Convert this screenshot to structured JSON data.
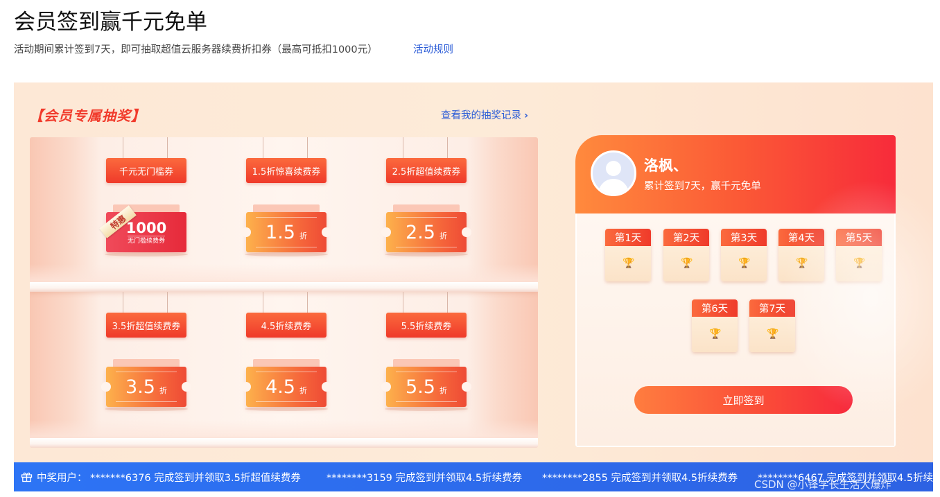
{
  "header": {
    "title": "会员签到赢千元免单",
    "description": "活动期间累计签到7天，即可抽取超值云服务器续费折扣券（最高可抵扣1000元）",
    "rules_link": "活动规则"
  },
  "lottery": {
    "title": "【会员专属抽奖】",
    "record_link": "查看我的抽奖记录",
    "prizes": [
      {
        "tag": "千元无门槛券",
        "value": "1000",
        "unit": "无门槛续费券",
        "ribbon": "特惠",
        "style": "red"
      },
      {
        "tag": "1.5折惊喜续费券",
        "value": "1.5",
        "unit": "折"
      },
      {
        "tag": "2.5折超值续费券",
        "value": "2.5",
        "unit": "折"
      },
      {
        "tag": "3.5折超值续费券",
        "value": "3.5",
        "unit": "折"
      },
      {
        "tag": "4.5折续费券",
        "value": "4.5",
        "unit": "折"
      },
      {
        "tag": "5.5折续费券",
        "value": "5.5",
        "unit": "折"
      }
    ]
  },
  "signin": {
    "user_name": "洛枫、",
    "subtitle": "累计签到7天，赢千元免单",
    "days": [
      "第1天",
      "第2天",
      "第3天",
      "第4天",
      "第5天",
      "第6天",
      "第7天"
    ],
    "button": "立即签到"
  },
  "ticker": {
    "label": "中奖用户：",
    "items": [
      "*******6376 完成签到并领取3.5折超值续费券",
      "********3159 完成签到并领取4.5折续费券",
      "********2855 完成签到并领取4.5折续费券",
      "********6467 完成签到并领取4.5折续"
    ]
  },
  "watermark": "CSDN @小锋学长生活大爆炸",
  "colors": {
    "accent_red": "#f13b2c",
    "link_blue": "#2a5bd7",
    "ticker_blue": "#2d6cf0"
  }
}
